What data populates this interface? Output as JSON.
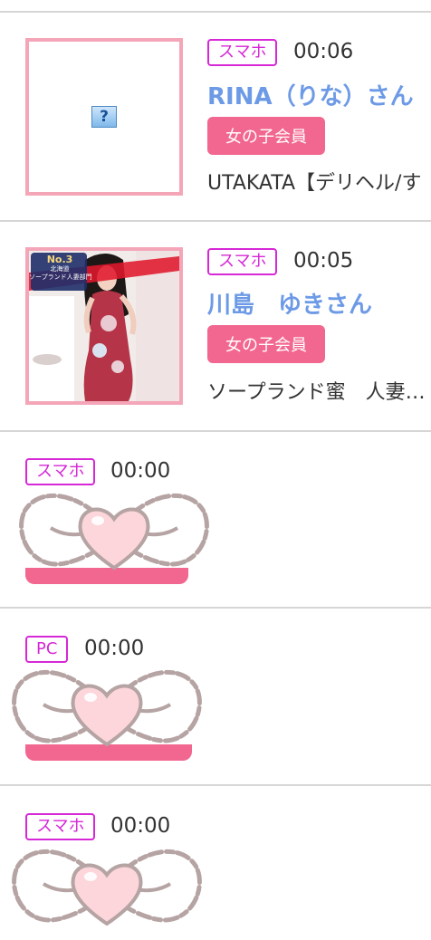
{
  "items": [
    {
      "device": "スマホ",
      "time": "00:06",
      "name": "RINA（りな）さん",
      "badge": "女の子会員",
      "desc": "UTAKATA【デリヘル/す",
      "thumb": "placeholder-icon"
    },
    {
      "device": "スマホ",
      "time": "00:05",
      "name": "川島　ゆきさん",
      "badge": "女の子会員",
      "desc": "ソープランド蜜　人妻…",
      "thumb": "photo",
      "photo_banner": {
        "rank": "No.3",
        "region": "北海道",
        "category": "ソープランド人妻部門"
      }
    },
    {
      "device": "スマホ",
      "time": "00:00",
      "overlay": "bow-heart-stamp"
    },
    {
      "device": "PC",
      "time": "00:00",
      "overlay": "bow-heart-stamp"
    },
    {
      "device": "スマホ",
      "time": "00:00",
      "overlay": "bow-heart-stamp"
    }
  ],
  "colors": {
    "device_border": "#d628d6",
    "name": "#6d9ae6",
    "badge_bg": "#f2678f",
    "thumb_border": "#f4a6b8",
    "divider": "#d6d6d6"
  }
}
